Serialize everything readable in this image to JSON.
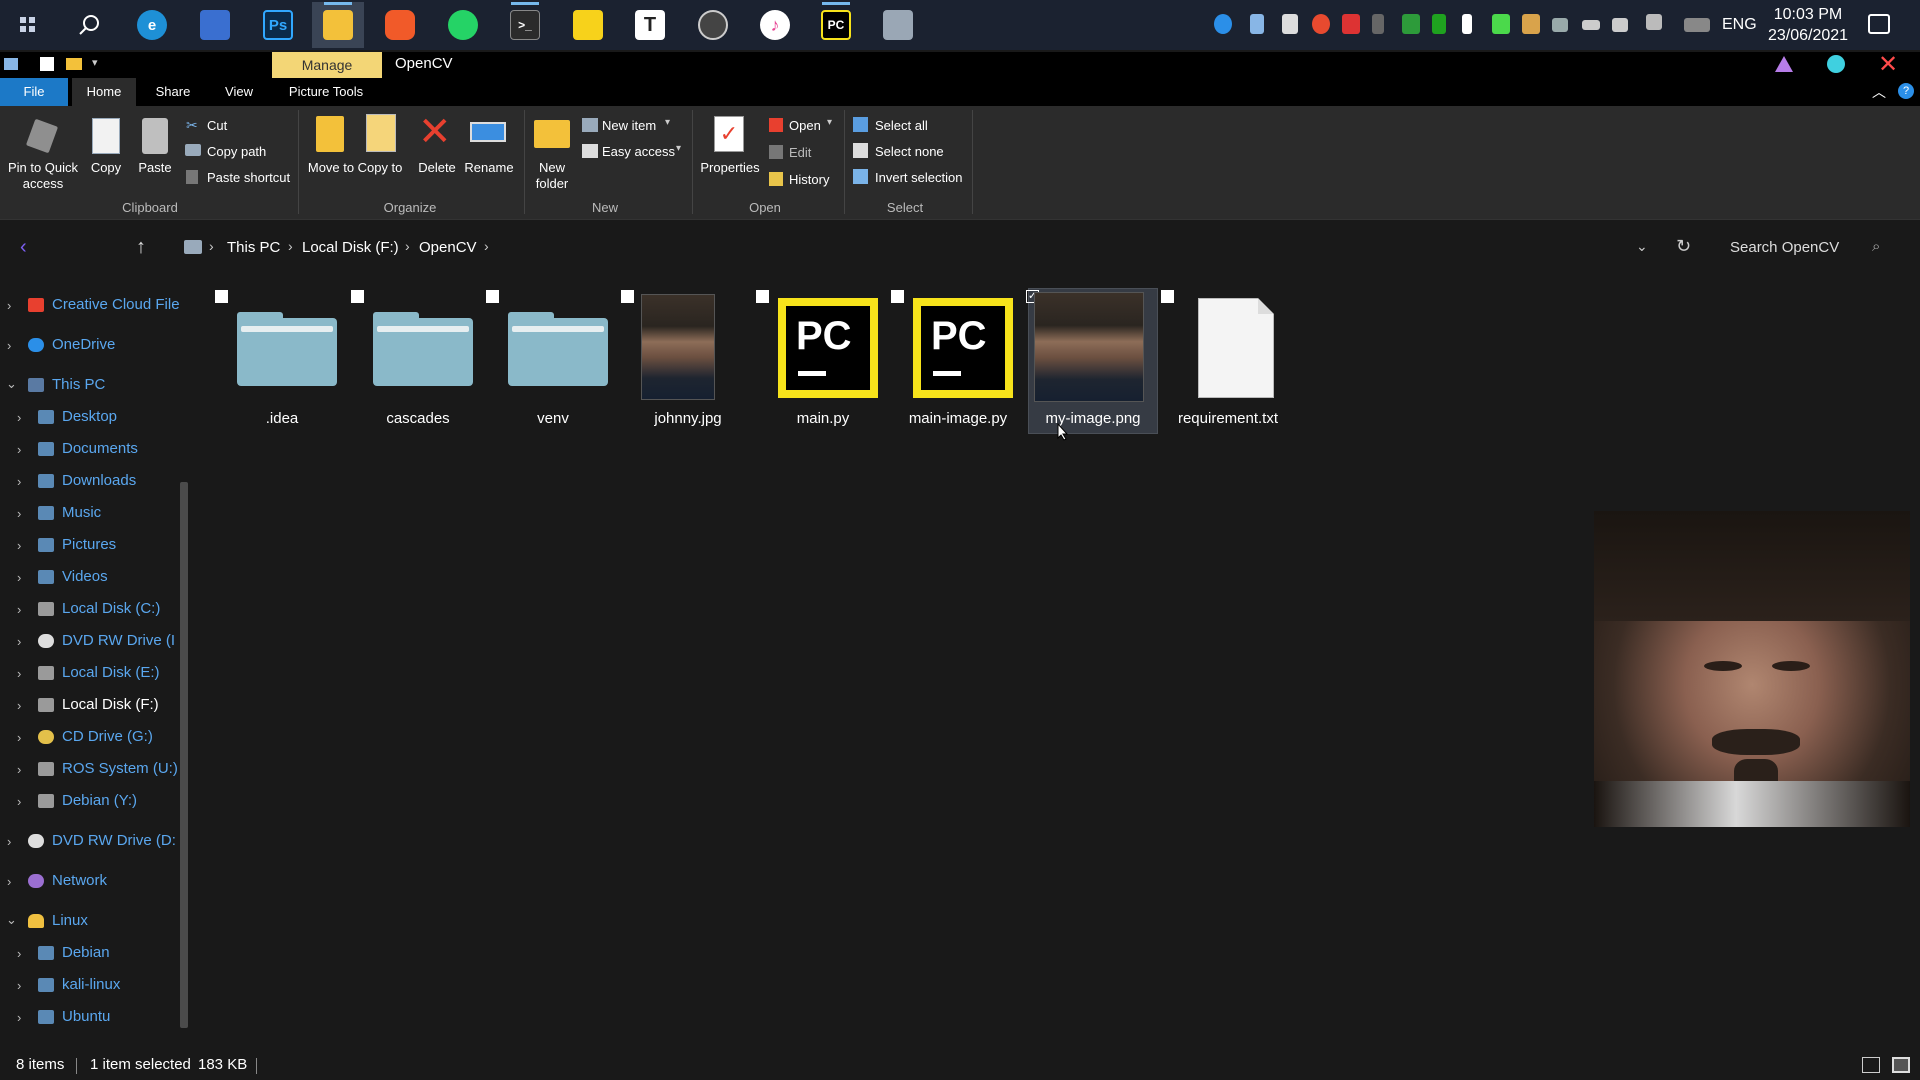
{
  "taskbar": {
    "apps": [
      {
        "name": "task-view",
        "label": "",
        "color": "#1b2230"
      },
      {
        "name": "search",
        "label": "",
        "color": "#1b2230"
      },
      {
        "name": "edge",
        "label": "e",
        "color": "#1e90d6"
      },
      {
        "name": "store",
        "label": "",
        "color": "#3a6fd0"
      },
      {
        "name": "photoshop",
        "label": "Ps",
        "color": "#0b2b4a"
      },
      {
        "name": "file-explorer",
        "label": "",
        "color": "#f3c13a"
      },
      {
        "name": "brave",
        "label": "",
        "color": "#f15a29"
      },
      {
        "name": "whatsapp",
        "label": "",
        "color": "#25d366"
      },
      {
        "name": "terminal",
        "label": ">_",
        "color": "#2b2b2b"
      },
      {
        "name": "sticky-notes",
        "label": "",
        "color": "#f7d21b"
      },
      {
        "name": "typora",
        "label": "T",
        "color": "#ffffff"
      },
      {
        "name": "obs",
        "label": "",
        "color": "#444"
      },
      {
        "name": "itunes",
        "label": "♪",
        "color": "#e84393"
      },
      {
        "name": "pycharm",
        "label": "PC",
        "color": "#000000"
      },
      {
        "name": "app-15",
        "label": "",
        "color": "#9aa7b5"
      }
    ],
    "language": "ENG",
    "time": "10:03 PM",
    "date": "23/06/2021"
  },
  "titlebar": {
    "manage_label": "Manage",
    "title": "OpenCV"
  },
  "ribbon_tabs": {
    "file": "File",
    "home": "Home",
    "share": "Share",
    "view": "View",
    "picture_tools": "Picture Tools"
  },
  "ribbon": {
    "clipboard": {
      "pin": "Pin to Quick access",
      "copy": "Copy",
      "paste": "Paste",
      "cut": "Cut",
      "copy_path": "Copy path",
      "paste_shortcut": "Paste shortcut",
      "group": "Clipboard"
    },
    "organize": {
      "move_to": "Move to",
      "copy_to": "Copy to",
      "delete": "Delete",
      "rename": "Rename",
      "group": "Organize"
    },
    "new": {
      "new_folder": "New folder",
      "new_item": "New item",
      "easy_access": "Easy access",
      "group": "New"
    },
    "open": {
      "properties": "Properties",
      "open": "Open",
      "edit": "Edit",
      "history": "History",
      "group": "Open"
    },
    "select": {
      "select_all": "Select all",
      "select_none": "Select none",
      "invert": "Invert selection",
      "group": "Select"
    }
  },
  "address": {
    "crumbs": [
      "This PC",
      "Local Disk (F:)",
      "OpenCV"
    ],
    "search_placeholder": "Search OpenCV"
  },
  "sidebar": {
    "items": [
      {
        "label": "Creative Cloud File",
        "color": "#e8402f"
      },
      {
        "label": "OneDrive",
        "color": "#2b8fe8"
      },
      {
        "label": "This PC",
        "color": "#5a7aa3"
      },
      {
        "label": "Desktop",
        "color": "#5a89b5"
      },
      {
        "label": "Documents",
        "color": "#5a89b5"
      },
      {
        "label": "Downloads",
        "color": "#5a89b5"
      },
      {
        "label": "Music",
        "color": "#5a89b5"
      },
      {
        "label": "Pictures",
        "color": "#5a89b5"
      },
      {
        "label": "Videos",
        "color": "#5a89b5"
      },
      {
        "label": "Local Disk (C:)",
        "color": "#9a9a9a"
      },
      {
        "label": "DVD RW Drive (I",
        "color": "#ddd"
      },
      {
        "label": "Local Disk (E:)",
        "color": "#9a9a9a"
      },
      {
        "label": "Local Disk (F:)",
        "color": "#9a9a9a"
      },
      {
        "label": "CD Drive (G:)",
        "color": "#e3c04a"
      },
      {
        "label": "ROS System (U:)",
        "color": "#9a9a9a"
      },
      {
        "label": "Debian (Y:)",
        "color": "#9a9a9a"
      },
      {
        "label": "DVD RW Drive (D:",
        "color": "#ddd"
      },
      {
        "label": "Network",
        "color": "#9b6fd1"
      },
      {
        "label": "Linux",
        "color": "#f0c040"
      },
      {
        "label": "Debian",
        "color": "#5a89b5"
      },
      {
        "label": "kali-linux",
        "color": "#5a89b5"
      },
      {
        "label": "Ubuntu",
        "color": "#5a89b5"
      }
    ]
  },
  "files": [
    {
      "name": ".idea",
      "type": "folder"
    },
    {
      "name": "cascades",
      "type": "folder"
    },
    {
      "name": "venv",
      "type": "folder"
    },
    {
      "name": "johnny.jpg",
      "type": "image"
    },
    {
      "name": "main.py",
      "type": "pycharm"
    },
    {
      "name": "main-image.py",
      "type": "pycharm"
    },
    {
      "name": "my-image.png",
      "type": "image",
      "selected": true
    },
    {
      "name": "requirement.txt",
      "type": "text"
    }
  ],
  "pycharm_icon_text": "PC",
  "status": {
    "count": "8 items",
    "selected": "1 item selected",
    "size": "183 KB"
  }
}
